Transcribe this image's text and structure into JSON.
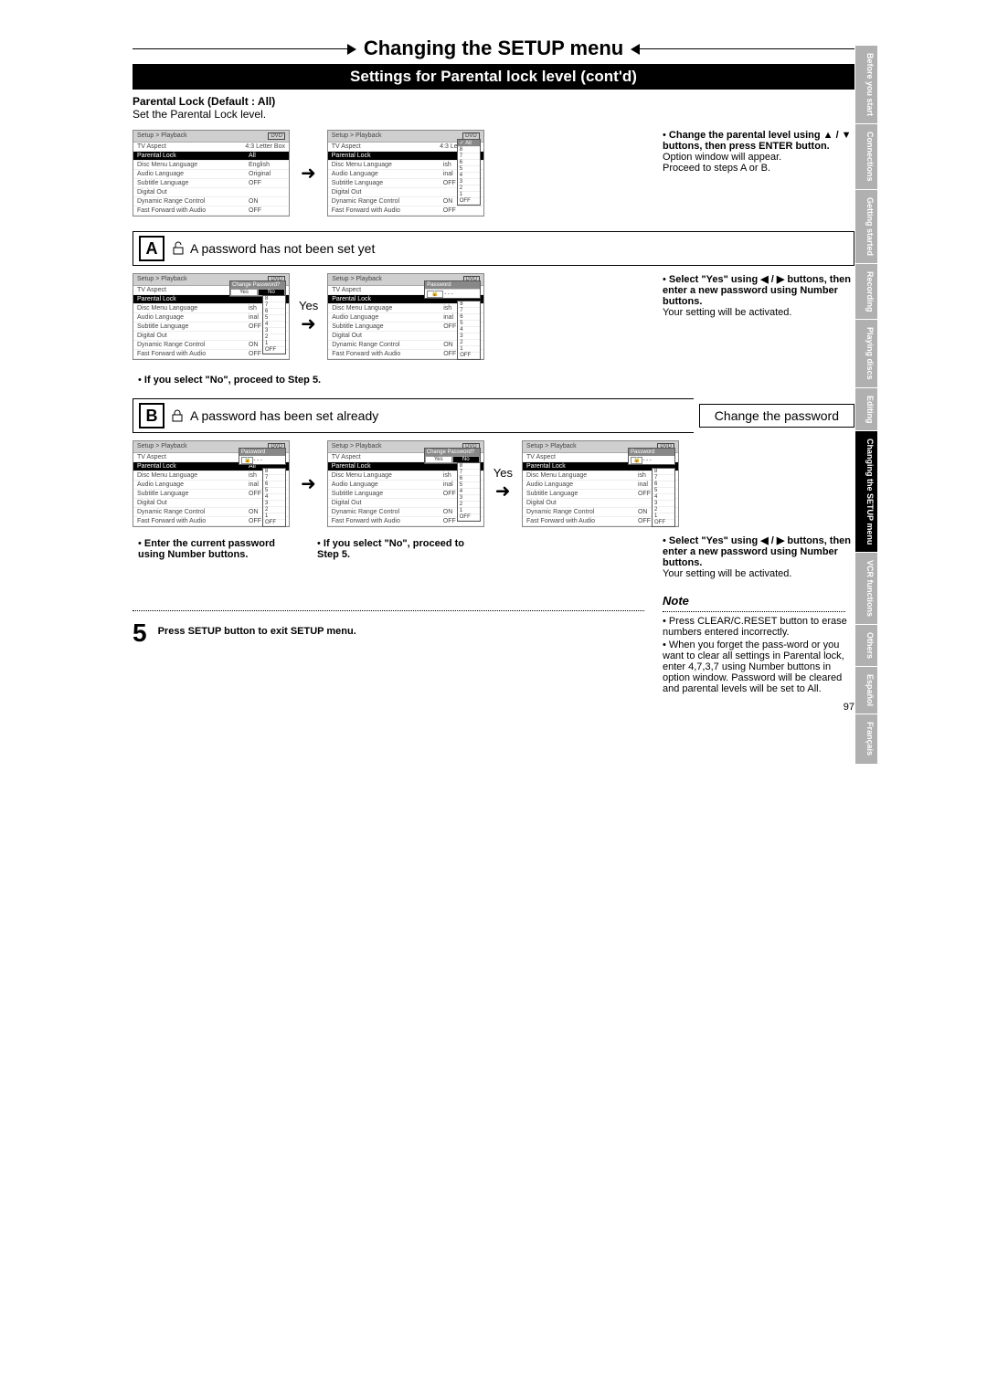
{
  "page_number": "97",
  "title": "Changing the SETUP menu",
  "subtitle": "Settings for Parental lock level (cont'd)",
  "intro_label": "Parental Lock (Default : All)",
  "intro_text": "Set the Parental Lock level.",
  "side_tabs": [
    "Before you start",
    "Connections",
    "Getting started",
    "Recording",
    "Playing discs",
    "Editing",
    "Changing the SETUP menu",
    "VCR functions",
    "Others",
    "Español",
    "Français"
  ],
  "current_side_tab_index": 6,
  "osd": {
    "breadcrumb": "Setup > Playback",
    "dvd_tag": "DVD",
    "rows": [
      {
        "label": "TV Aspect",
        "value": "4:3 Letter Box"
      },
      {
        "label": "Parental Lock",
        "value": "All"
      },
      {
        "label": "Disc Menu Language",
        "value": "English"
      },
      {
        "label": "Audio Language",
        "value": "Original"
      },
      {
        "label": "Subtitle Language",
        "value": "OFF"
      },
      {
        "label": "Digital Out",
        "value": ""
      },
      {
        "label": "Dynamic Range Control",
        "value": "ON"
      },
      {
        "label": "Fast Forward with Audio",
        "value": "OFF"
      }
    ],
    "levels": [
      "8",
      "7",
      "6",
      "5",
      "4",
      "3",
      "2",
      "1",
      "OFF"
    ],
    "levels_all_sel": "All",
    "change_pw_title": "Change Password?",
    "change_pw_yes": "Yes",
    "change_pw_no": "No",
    "password_title": "Password",
    "password_mask": "- - -"
  },
  "yes_label": "Yes",
  "instr_top": {
    "bold": "Change the parental level using ▲ / ▼ buttons, then press ENTER button.",
    "line1": "Option window will appear.",
    "line2": "Proceed to steps A or B."
  },
  "section_a": {
    "letter": "A",
    "heading": "A password has not been set yet",
    "note": "If you select \"No\", proceed to Step 5.",
    "instr_bold": "Select \"Yes\" using ◀ / ▶ buttons, then enter a new password using Number buttons.",
    "instr_line": "Your setting will be activated."
  },
  "section_b": {
    "letter": "B",
    "heading": "A password has been set already",
    "right_heading": "Change the password",
    "instr1": "Enter the current password using Number buttons.",
    "instr2": "If you select \"No\", proceed to Step 5.",
    "instr3_bold": "Select \"Yes\" using ◀ / ▶ buttons, then enter a new password using Number buttons.",
    "instr3_line": "Your setting will be activated."
  },
  "step5": {
    "num": "5",
    "text": "Press SETUP button to exit SETUP menu."
  },
  "note": {
    "title": "Note",
    "items": [
      "Press CLEAR/C.RESET button to erase numbers entered incorrectly.",
      "When you forget the pass-word or you want to clear all settings in Parental lock, enter 4,7,3,7 using Number buttons in option window. Password will be cleared and parental levels will be set to All."
    ]
  }
}
